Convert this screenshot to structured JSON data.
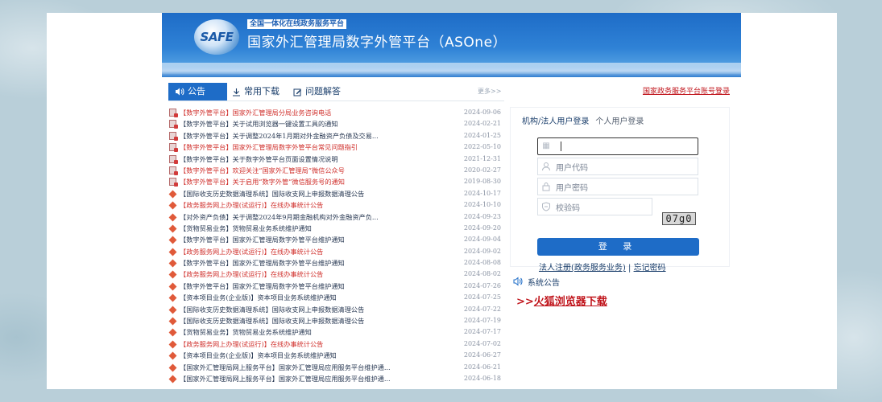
{
  "banner": {
    "logo_text": "SAFE",
    "tagline": "全国一体化在线政务服务平台",
    "title": "国家外汇管理局数字外管平台（ASOne）"
  },
  "tabs": {
    "announcement": "公告",
    "downloads": "常用下载",
    "faq": "问题解答",
    "more": "更多>>",
    "gov_login": "国家政务服务平台账号登录"
  },
  "news": [
    {
      "tag": "【数字外管平台】",
      "title": "国家外汇管理局分局业务咨询电话",
      "date": "2024-09-06",
      "red": true,
      "icon": "doc"
    },
    {
      "tag": "【数字外管平台】",
      "title": "关于试用浏览器一键设置工具的通知",
      "date": "2024-02-21",
      "red": false,
      "icon": "doc"
    },
    {
      "tag": "【数字外管平台】",
      "title": "关于调整2024年1月期对外金融资产负债及交易...",
      "date": "2024-01-25",
      "red": false,
      "icon": "doc"
    },
    {
      "tag": "【数字外管平台】",
      "title": "国家外汇管理局数字外管平台常见问题指引",
      "date": "2022-05-10",
      "red": true,
      "icon": "doc"
    },
    {
      "tag": "【数字外管平台】",
      "title": "关于数字外管平台页面设置情况说明",
      "date": "2021-12-31",
      "red": false,
      "icon": "doc"
    },
    {
      "tag": "【数字外管平台】",
      "title": "欢迎关注“国家外汇管理局”微信公众号",
      "date": "2020-02-27",
      "red": true,
      "icon": "doc"
    },
    {
      "tag": "【数字外管平台】",
      "title": "关于启用“数字外管”微信服务号的通知",
      "date": "2019-08-30",
      "red": true,
      "icon": "doc"
    },
    {
      "tag": "【国际收支历史数据清理系统】",
      "title": "国际收支网上申报数据清理公告",
      "date": "2024-10-17",
      "red": false,
      "icon": "dia"
    },
    {
      "tag": "【政务服务网上办理(试运行)】",
      "title": "在线办事统计公告",
      "date": "2024-10-10",
      "red": true,
      "icon": "dia"
    },
    {
      "tag": "【对外资产负债】",
      "title": "关于调整2024年9月期金融机构对外金融资产负...",
      "date": "2024-09-23",
      "red": false,
      "icon": "dia"
    },
    {
      "tag": "【货物贸易业务】",
      "title": "货物贸易业务系统维护通知",
      "date": "2024-09-20",
      "red": false,
      "icon": "dia"
    },
    {
      "tag": "【数字外管平台】",
      "title": "国家外汇管理局数字外管平台维护通知",
      "date": "2024-09-04",
      "red": false,
      "icon": "dia"
    },
    {
      "tag": "【政务服务网上办理(试运行)】",
      "title": "在线办事统计公告",
      "date": "2024-09-02",
      "red": true,
      "icon": "dia"
    },
    {
      "tag": "【数字外管平台】",
      "title": "国家外汇管理局数字外管平台维护通知",
      "date": "2024-08-08",
      "red": false,
      "icon": "dia"
    },
    {
      "tag": "【政务服务网上办理(试运行)】",
      "title": "在线办事统计公告",
      "date": "2024-08-02",
      "red": true,
      "icon": "dia"
    },
    {
      "tag": "【数字外管平台】",
      "title": "国家外汇管理局数字外管平台维护通知",
      "date": "2024-07-26",
      "red": false,
      "icon": "dia"
    },
    {
      "tag": "【资本项目业务(企业版)】",
      "title": "资本项目业务系统维护通知",
      "date": "2024-07-25",
      "red": false,
      "icon": "dia"
    },
    {
      "tag": "【国际收支历史数据清理系统】",
      "title": "国际收支网上申报数据清理公告",
      "date": "2024-07-22",
      "red": false,
      "icon": "dia"
    },
    {
      "tag": "【国际收支历史数据清理系统】",
      "title": "国际收支网上申报数据清理公告",
      "date": "2024-07-19",
      "red": false,
      "icon": "dia"
    },
    {
      "tag": "【货物贸易业务】",
      "title": "货物贸易业务系统维护通知",
      "date": "2024-07-17",
      "red": false,
      "icon": "dia"
    },
    {
      "tag": "【政务服务网上办理(试运行)】",
      "title": "在线办事统计公告",
      "date": "2024-07-02",
      "red": true,
      "icon": "dia"
    },
    {
      "tag": "【资本项目业务(企业版)】",
      "title": "资本项目业务系统维护通知",
      "date": "2024-06-27",
      "red": false,
      "icon": "dia"
    },
    {
      "tag": "【国家外汇管理局网上服务平台】",
      "title": "国家外汇管理局应用服务平台维护通...",
      "date": "2024-06-21",
      "red": false,
      "icon": "dia"
    },
    {
      "tag": "【国家外汇管理局网上服务平台】",
      "title": "国家外汇管理局应用服务平台维护通...",
      "date": "2024-06-18",
      "red": false,
      "icon": "dia"
    }
  ],
  "login": {
    "tab_org": "机构/法人用户登录",
    "tab_personal": "个人用户登录",
    "org_field_value": "",
    "user_code_placeholder": "用户代码",
    "password_placeholder": "用户密码",
    "captcha_placeholder": "校验码",
    "captcha_text": "07g0",
    "submit_label": "登 录",
    "register_link": "法人注册(政务服务业务)",
    "separator": "|",
    "forgot_link": "忘记密码"
  },
  "system_notice": {
    "label": "系统公告",
    "arrows": ">>",
    "firefox_link": "火狐浏览器下载"
  },
  "colors": {
    "accent": "#1e6cc7",
    "alert_red": "#c0141b"
  }
}
